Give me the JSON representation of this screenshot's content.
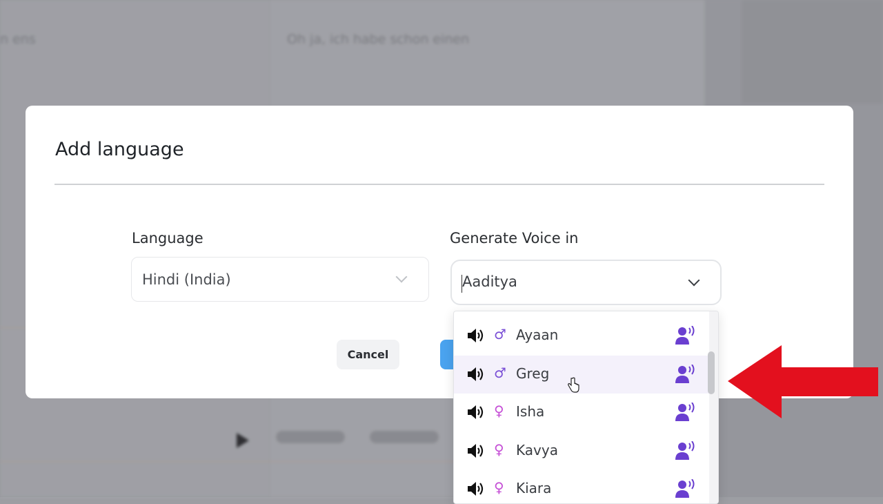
{
  "background": {
    "left_text": "n ens",
    "mid_text": "Oh ja, ich habe schon einen"
  },
  "modal": {
    "title": "Add language",
    "language": {
      "label": "Language",
      "value": "Hindi (India)"
    },
    "voice": {
      "label": "Generate Voice in",
      "value": "Aaditya"
    },
    "cancel_label": "Cancel"
  },
  "dropdown": {
    "options": [
      {
        "name": "Ayaan",
        "gender": "male",
        "gender_symbol": "♂",
        "icon": "speaker-icon",
        "badge_icon": "ai-voice-icon"
      },
      {
        "name": "Greg",
        "gender": "male",
        "gender_symbol": "♂",
        "icon": "speaker-icon",
        "badge_icon": "ai-voice-icon",
        "hovered": true
      },
      {
        "name": "Isha",
        "gender": "female",
        "gender_symbol": "♀",
        "icon": "speaker-icon",
        "badge_icon": "ai-voice-icon"
      },
      {
        "name": "Kavya",
        "gender": "female",
        "gender_symbol": "♀",
        "icon": "speaker-icon",
        "badge_icon": "ai-voice-icon"
      },
      {
        "name": "Kiara",
        "gender": "female",
        "gender_symbol": "♀",
        "icon": "speaker-icon",
        "badge_icon": "ai-voice-icon"
      }
    ]
  },
  "colors": {
    "male": "#7a4fd6",
    "female": "#c54fd6",
    "ai_badge": "#6a3fd0",
    "primary_button": "#4aa3ef",
    "annotation_arrow": "#e3101e"
  }
}
